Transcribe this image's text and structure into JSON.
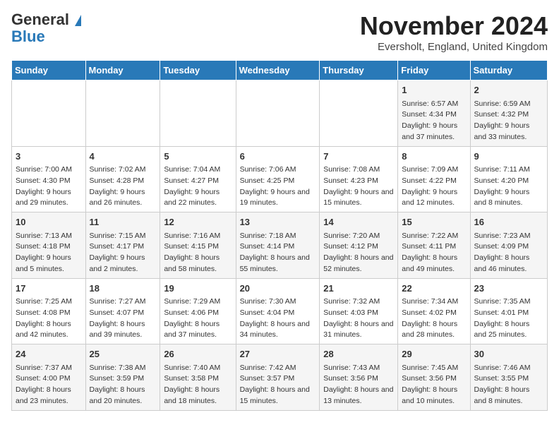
{
  "logo": {
    "line1": "General",
    "line2": "Blue"
  },
  "title": "November 2024",
  "location": "Eversholt, England, United Kingdom",
  "weekdays": [
    "Sunday",
    "Monday",
    "Tuesday",
    "Wednesday",
    "Thursday",
    "Friday",
    "Saturday"
  ],
  "weeks": [
    [
      {
        "day": "",
        "sunrise": "",
        "sunset": "",
        "daylight": ""
      },
      {
        "day": "",
        "sunrise": "",
        "sunset": "",
        "daylight": ""
      },
      {
        "day": "",
        "sunrise": "",
        "sunset": "",
        "daylight": ""
      },
      {
        "day": "",
        "sunrise": "",
        "sunset": "",
        "daylight": ""
      },
      {
        "day": "",
        "sunrise": "",
        "sunset": "",
        "daylight": ""
      },
      {
        "day": "1",
        "sunrise": "Sunrise: 6:57 AM",
        "sunset": "Sunset: 4:34 PM",
        "daylight": "Daylight: 9 hours and 37 minutes."
      },
      {
        "day": "2",
        "sunrise": "Sunrise: 6:59 AM",
        "sunset": "Sunset: 4:32 PM",
        "daylight": "Daylight: 9 hours and 33 minutes."
      }
    ],
    [
      {
        "day": "3",
        "sunrise": "Sunrise: 7:00 AM",
        "sunset": "Sunset: 4:30 PM",
        "daylight": "Daylight: 9 hours and 29 minutes."
      },
      {
        "day": "4",
        "sunrise": "Sunrise: 7:02 AM",
        "sunset": "Sunset: 4:28 PM",
        "daylight": "Daylight: 9 hours and 26 minutes."
      },
      {
        "day": "5",
        "sunrise": "Sunrise: 7:04 AM",
        "sunset": "Sunset: 4:27 PM",
        "daylight": "Daylight: 9 hours and 22 minutes."
      },
      {
        "day": "6",
        "sunrise": "Sunrise: 7:06 AM",
        "sunset": "Sunset: 4:25 PM",
        "daylight": "Daylight: 9 hours and 19 minutes."
      },
      {
        "day": "7",
        "sunrise": "Sunrise: 7:08 AM",
        "sunset": "Sunset: 4:23 PM",
        "daylight": "Daylight: 9 hours and 15 minutes."
      },
      {
        "day": "8",
        "sunrise": "Sunrise: 7:09 AM",
        "sunset": "Sunset: 4:22 PM",
        "daylight": "Daylight: 9 hours and 12 minutes."
      },
      {
        "day": "9",
        "sunrise": "Sunrise: 7:11 AM",
        "sunset": "Sunset: 4:20 PM",
        "daylight": "Daylight: 9 hours and 8 minutes."
      }
    ],
    [
      {
        "day": "10",
        "sunrise": "Sunrise: 7:13 AM",
        "sunset": "Sunset: 4:18 PM",
        "daylight": "Daylight: 9 hours and 5 minutes."
      },
      {
        "day": "11",
        "sunrise": "Sunrise: 7:15 AM",
        "sunset": "Sunset: 4:17 PM",
        "daylight": "Daylight: 9 hours and 2 minutes."
      },
      {
        "day": "12",
        "sunrise": "Sunrise: 7:16 AM",
        "sunset": "Sunset: 4:15 PM",
        "daylight": "Daylight: 8 hours and 58 minutes."
      },
      {
        "day": "13",
        "sunrise": "Sunrise: 7:18 AM",
        "sunset": "Sunset: 4:14 PM",
        "daylight": "Daylight: 8 hours and 55 minutes."
      },
      {
        "day": "14",
        "sunrise": "Sunrise: 7:20 AM",
        "sunset": "Sunset: 4:12 PM",
        "daylight": "Daylight: 8 hours and 52 minutes."
      },
      {
        "day": "15",
        "sunrise": "Sunrise: 7:22 AM",
        "sunset": "Sunset: 4:11 PM",
        "daylight": "Daylight: 8 hours and 49 minutes."
      },
      {
        "day": "16",
        "sunrise": "Sunrise: 7:23 AM",
        "sunset": "Sunset: 4:09 PM",
        "daylight": "Daylight: 8 hours and 46 minutes."
      }
    ],
    [
      {
        "day": "17",
        "sunrise": "Sunrise: 7:25 AM",
        "sunset": "Sunset: 4:08 PM",
        "daylight": "Daylight: 8 hours and 42 minutes."
      },
      {
        "day": "18",
        "sunrise": "Sunrise: 7:27 AM",
        "sunset": "Sunset: 4:07 PM",
        "daylight": "Daylight: 8 hours and 39 minutes."
      },
      {
        "day": "19",
        "sunrise": "Sunrise: 7:29 AM",
        "sunset": "Sunset: 4:06 PM",
        "daylight": "Daylight: 8 hours and 37 minutes."
      },
      {
        "day": "20",
        "sunrise": "Sunrise: 7:30 AM",
        "sunset": "Sunset: 4:04 PM",
        "daylight": "Daylight: 8 hours and 34 minutes."
      },
      {
        "day": "21",
        "sunrise": "Sunrise: 7:32 AM",
        "sunset": "Sunset: 4:03 PM",
        "daylight": "Daylight: 8 hours and 31 minutes."
      },
      {
        "day": "22",
        "sunrise": "Sunrise: 7:34 AM",
        "sunset": "Sunset: 4:02 PM",
        "daylight": "Daylight: 8 hours and 28 minutes."
      },
      {
        "day": "23",
        "sunrise": "Sunrise: 7:35 AM",
        "sunset": "Sunset: 4:01 PM",
        "daylight": "Daylight: 8 hours and 25 minutes."
      }
    ],
    [
      {
        "day": "24",
        "sunrise": "Sunrise: 7:37 AM",
        "sunset": "Sunset: 4:00 PM",
        "daylight": "Daylight: 8 hours and 23 minutes."
      },
      {
        "day": "25",
        "sunrise": "Sunrise: 7:38 AM",
        "sunset": "Sunset: 3:59 PM",
        "daylight": "Daylight: 8 hours and 20 minutes."
      },
      {
        "day": "26",
        "sunrise": "Sunrise: 7:40 AM",
        "sunset": "Sunset: 3:58 PM",
        "daylight": "Daylight: 8 hours and 18 minutes."
      },
      {
        "day": "27",
        "sunrise": "Sunrise: 7:42 AM",
        "sunset": "Sunset: 3:57 PM",
        "daylight": "Daylight: 8 hours and 15 minutes."
      },
      {
        "day": "28",
        "sunrise": "Sunrise: 7:43 AM",
        "sunset": "Sunset: 3:56 PM",
        "daylight": "Daylight: 8 hours and 13 minutes."
      },
      {
        "day": "29",
        "sunrise": "Sunrise: 7:45 AM",
        "sunset": "Sunset: 3:56 PM",
        "daylight": "Daylight: 8 hours and 10 minutes."
      },
      {
        "day": "30",
        "sunrise": "Sunrise: 7:46 AM",
        "sunset": "Sunset: 3:55 PM",
        "daylight": "Daylight: 8 hours and 8 minutes."
      }
    ]
  ]
}
